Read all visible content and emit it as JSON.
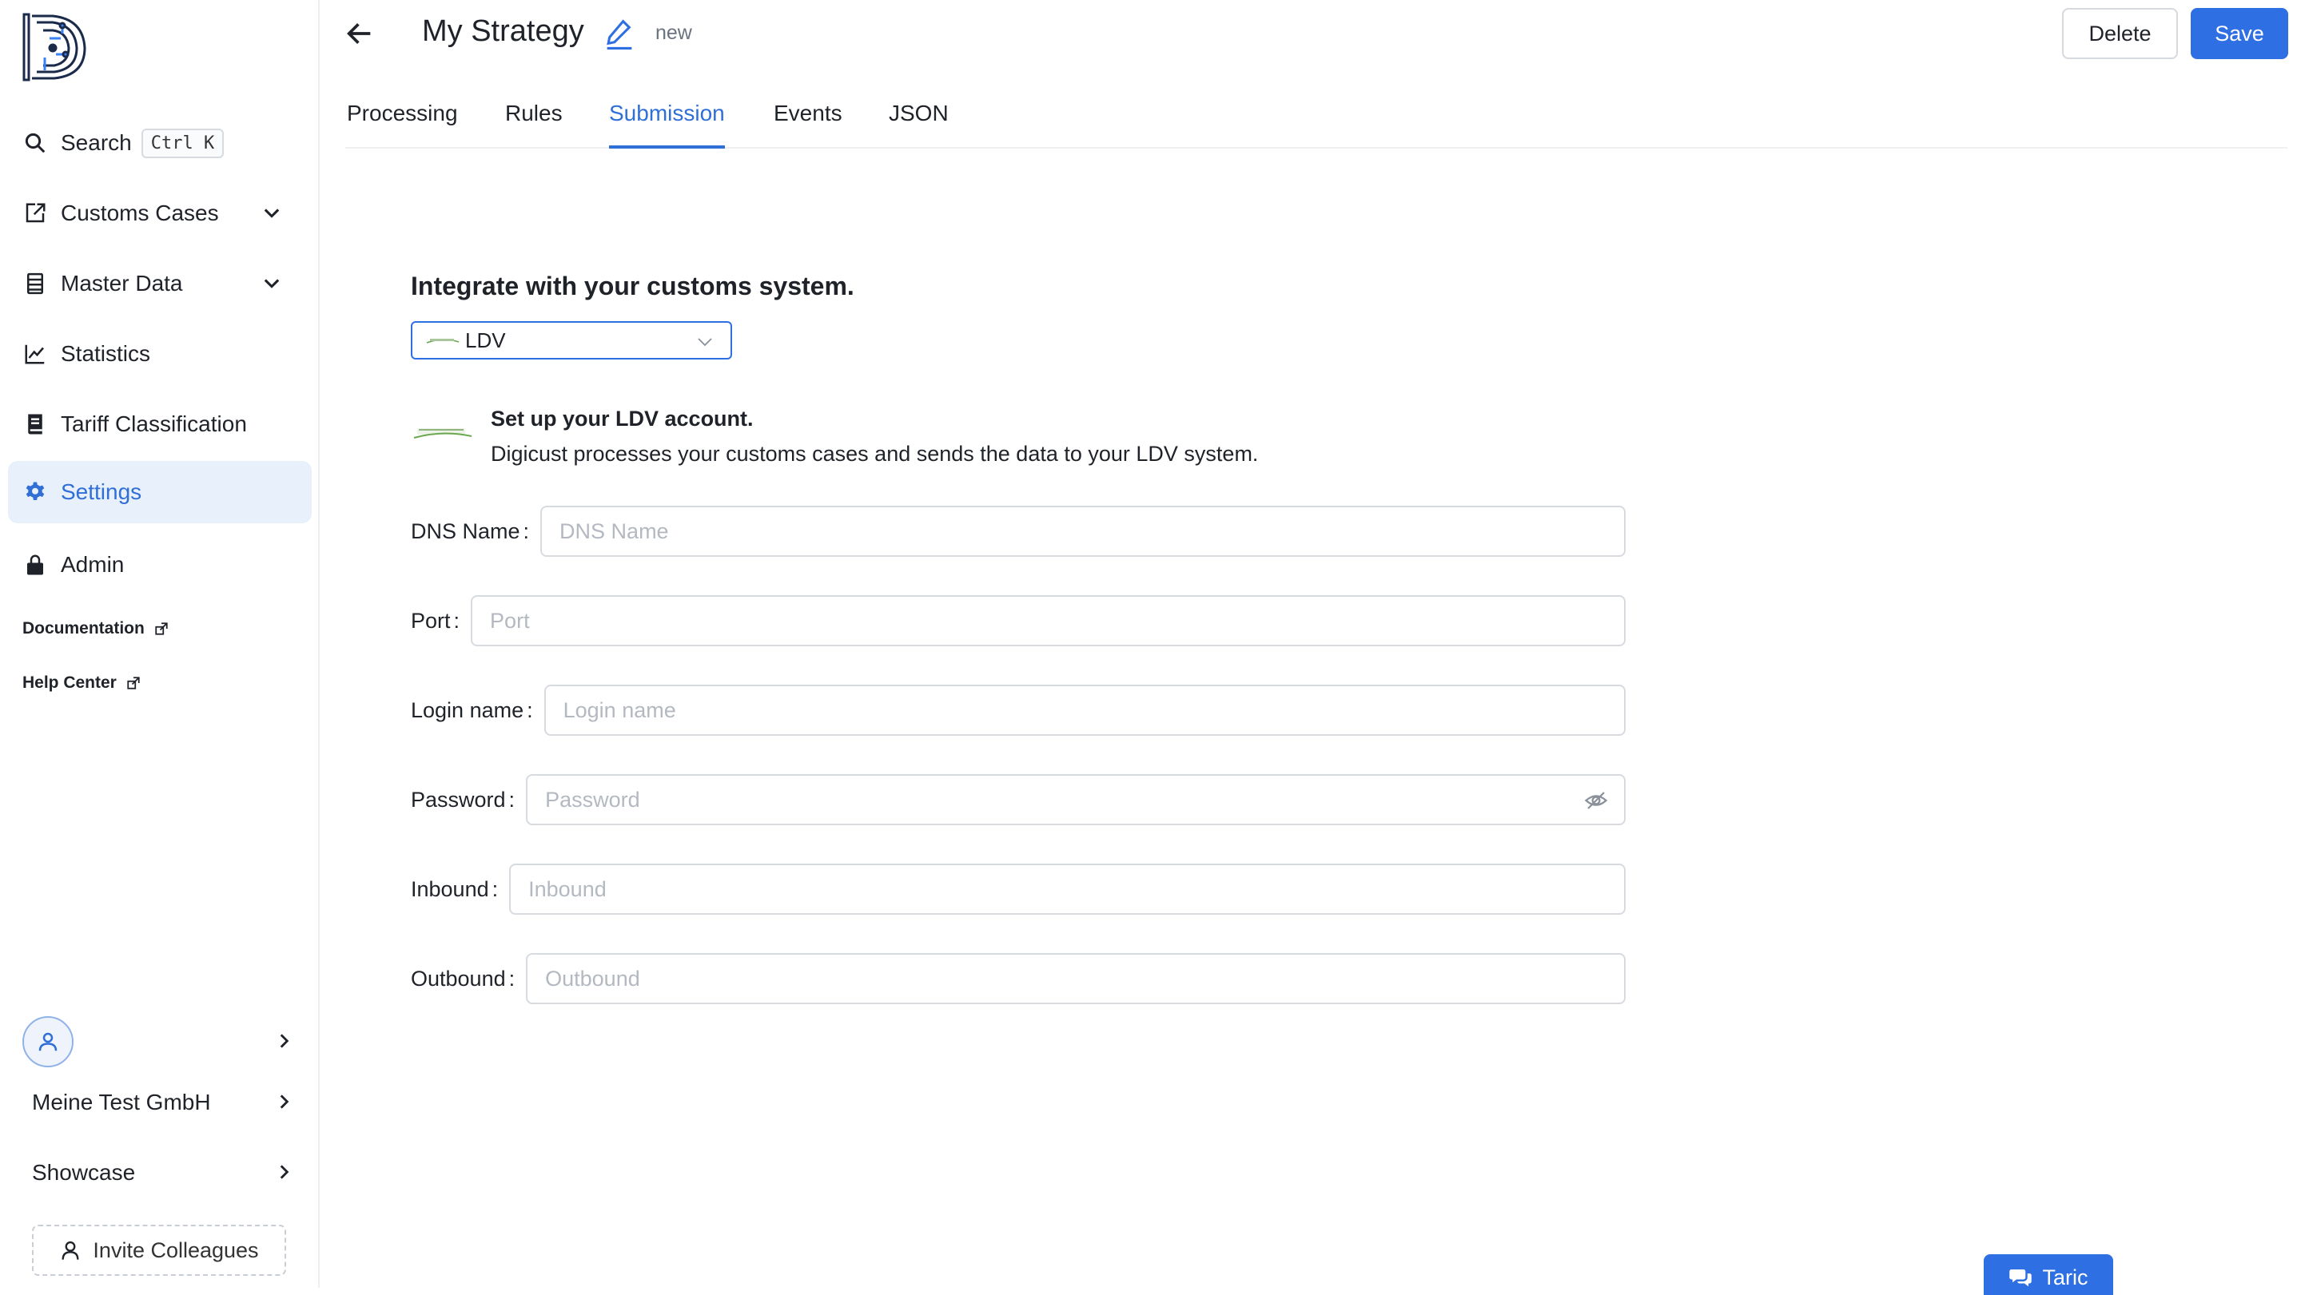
{
  "sidebar": {
    "search_label": "Search",
    "search_shortcut": "Ctrl K",
    "items": [
      {
        "label": "Customs Cases"
      },
      {
        "label": "Master Data"
      },
      {
        "label": "Statistics"
      },
      {
        "label": "Tariff Classification"
      },
      {
        "label": "Settings"
      },
      {
        "label": "Admin"
      }
    ],
    "links": [
      {
        "label": "Documentation"
      },
      {
        "label": "Help Center"
      }
    ],
    "company": "Meine Test GmbH",
    "showcase": "Showcase",
    "invite": "Invite Colleagues"
  },
  "header": {
    "title": "My Strategy",
    "status": "new",
    "delete_label": "Delete",
    "save_label": "Save"
  },
  "tabs": [
    {
      "label": "Processing"
    },
    {
      "label": "Rules"
    },
    {
      "label": "Submission"
    },
    {
      "label": "Events"
    },
    {
      "label": "JSON"
    }
  ],
  "submission": {
    "title": "Integrate with your customs system.",
    "selected_system": "LDV",
    "info_title": "Set up your LDV account.",
    "info_desc": "Digicust processes your customs cases and sends the data to your LDV system.",
    "fields": {
      "dns": {
        "label": "DNS Name",
        "placeholder": "DNS Name",
        "value": ""
      },
      "port": {
        "label": "Port",
        "placeholder": "Port",
        "value": ""
      },
      "login": {
        "label": "Login name",
        "placeholder": "Login name",
        "value": ""
      },
      "password": {
        "label": "Password",
        "placeholder": "Password",
        "value": ""
      },
      "inbound": {
        "label": "Inbound",
        "placeholder": "Inbound",
        "value": ""
      },
      "outbound": {
        "label": "Outbound",
        "placeholder": "Outbound",
        "value": ""
      }
    }
  },
  "taric_label": "Taric",
  "colors": {
    "accent": "#2f6fe4",
    "active_bg": "#e8f0fc",
    "ldv_green": "#6aa84f"
  }
}
